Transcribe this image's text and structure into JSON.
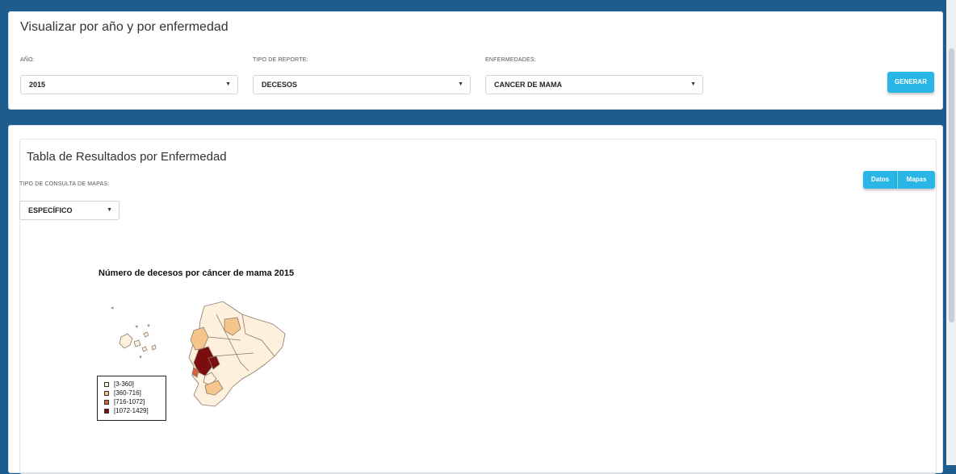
{
  "filters": {
    "title": "Visualizar por año y por enfermedad",
    "year": {
      "label": "AÑO:",
      "value": "2015"
    },
    "report_type": {
      "label": "TIPO DE REPORTE:",
      "value": "DECESOS"
    },
    "disease": {
      "label": "ENFERMEDADES:",
      "value": "CANCER DE MAMA"
    },
    "generate_label": "GENERAR"
  },
  "results": {
    "title": "Tabla de Resultados por Enfermedad",
    "map_query": {
      "label": "TIPO DE CONSULTA DE MAPAS:",
      "value": "ESPECÍFICO"
    },
    "tabs": [
      {
        "label": "Datos"
      },
      {
        "label": "Mapas"
      }
    ],
    "map": {
      "title": "Número de decesos por cáncer de mama 2015",
      "legend": [
        {
          "label": "[3-360]",
          "color": "#fdf0dc"
        },
        {
          "label": "[360-716]",
          "color": "#f6c58c"
        },
        {
          "label": "[716-1072]",
          "color": "#d9603b"
        },
        {
          "label": "[1072-1429]",
          "color": "#7a0d0d"
        }
      ]
    }
  },
  "colors": {
    "frame": "#1d5c8e",
    "button": "#29b6e6"
  }
}
